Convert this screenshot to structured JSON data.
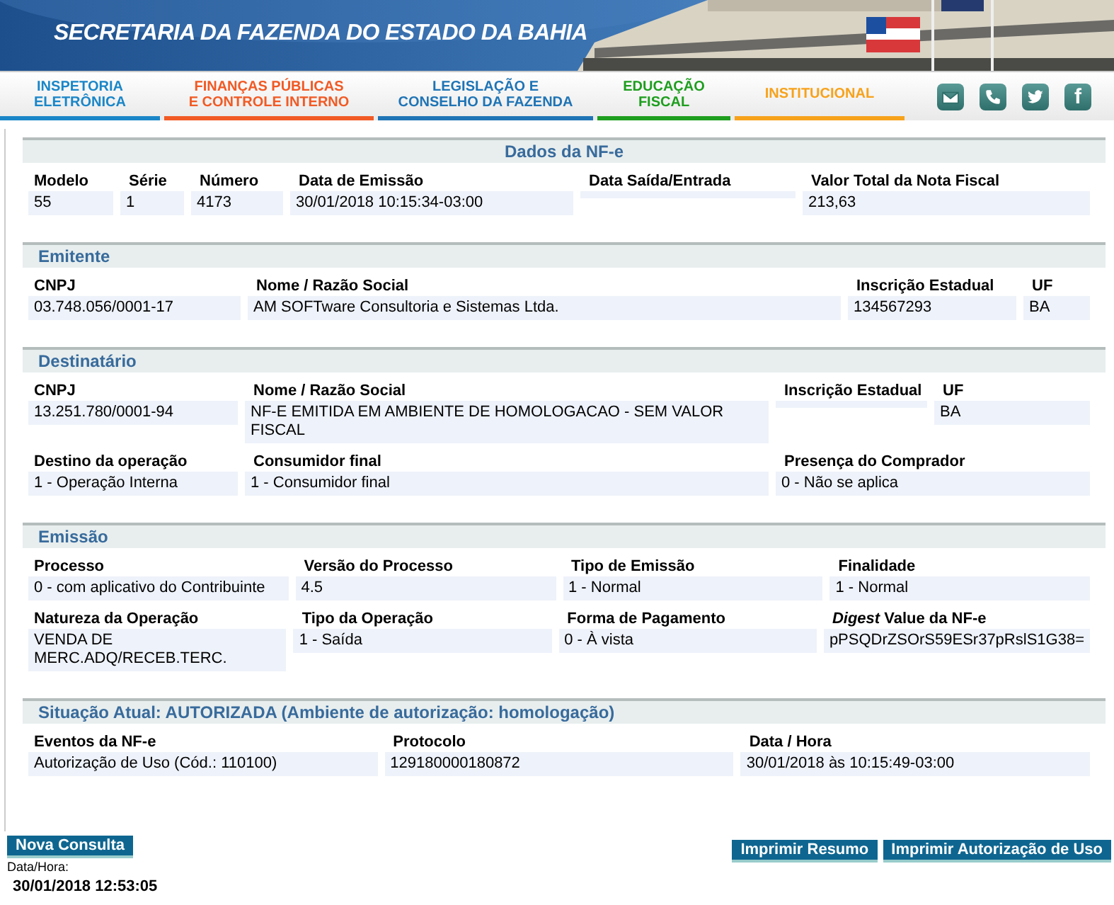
{
  "header": {
    "title": "SECRETARIA DA FAZENDA DO ESTADO DA BAHIA"
  },
  "nav": [
    {
      "lines": [
        "INSPETORIA",
        "ELETRÔNICA"
      ],
      "color": "#1a86c8"
    },
    {
      "lines": [
        "FINANÇAS PÚBLICAS",
        "E CONTROLE INTERNO"
      ],
      "color": "#f15a24"
    },
    {
      "lines": [
        "LEGISLAÇÃO E",
        "CONSELHO DA FAZENDA"
      ],
      "color": "#1f74b5"
    },
    {
      "lines": [
        "EDUCAÇÃO",
        "FISCAL"
      ],
      "color": "#1e9e1e"
    },
    {
      "lines": [
        "INSTITUCIONAL"
      ],
      "color": "#f7a21b"
    }
  ],
  "social": [
    {
      "kind": "mail"
    },
    {
      "kind": "phone"
    },
    {
      "kind": "twitter"
    },
    {
      "kind": "facebook",
      "glyph": "f"
    }
  ],
  "sections": [
    {
      "title": "Dados da NF-e",
      "centered": true,
      "rows": [
        [
          {
            "label": "Modelo",
            "value": "55"
          },
          {
            "label": "Série",
            "value": "1"
          },
          {
            "label": "Número",
            "value": "4173"
          },
          {
            "label": "Data de Emissão",
            "value": "30/01/2018 10:15:34-03:00"
          },
          {
            "label": "Data Saída/Entrada"
          },
          {
            "label": "Valor Total da Nota Fiscal",
            "value": "213,63"
          }
        ]
      ]
    },
    {
      "title": "Emitente",
      "centered": false,
      "rows": [
        [
          {
            "label": "CNPJ",
            "value": "03.748.056/0001-17"
          },
          {
            "label": "Nome / Razão Social",
            "value": "AM SOFTware Consultoria e Sistemas Ltda."
          },
          {
            "label": "Inscrição Estadual",
            "value": "134567293"
          },
          {
            "label": "UF",
            "value": "BA"
          }
        ]
      ]
    },
    {
      "title": "Destinatário",
      "centered": false,
      "rows": [
        [
          {
            "label": "CNPJ",
            "value": "13.251.780/0001-94"
          },
          {
            "label": "Nome / Razão Social",
            "value": "NF-E EMITIDA EM AMBIENTE DE HOMOLOGACAO - SEM VALOR FISCAL"
          },
          {
            "label": "Inscrição Estadual"
          },
          {
            "label": "UF",
            "value": "BA"
          }
        ],
        [
          {
            "label": "Destino da operação",
            "value": "1 - Operação Interna"
          },
          {
            "label": "Consumidor final",
            "value": "1 - Consumidor final"
          },
          {
            "label": "Presença do Comprador",
            "value": "0 - Não se aplica"
          }
        ]
      ]
    },
    {
      "title": "Emissão",
      "centered": false,
      "rows": [
        [
          {
            "label": "Processo",
            "value": "0 - com aplicativo do Contribuinte"
          },
          {
            "label": "Versão do Processo",
            "value": "4.5"
          },
          {
            "label": "Tipo de Emissão",
            "value": "1 - Normal"
          },
          {
            "label": "Finalidade",
            "value": "1 - Normal"
          }
        ],
        [
          {
            "label": "Natureza da Operação",
            "value": "VENDA DE MERC.ADQ/RECEB.TERC."
          },
          {
            "label": "Tipo da Operação",
            "value": "1 - Saída"
          },
          {
            "label": "Forma de Pagamento",
            "value": "0 - À vista"
          },
          {
            "label": "*Digest* Value da NF-e",
            "value": "pPSQDrZSOrS59ESr37pRslS1G38="
          }
        ]
      ]
    },
    {
      "title": "Situação Atual:  AUTORIZADA (Ambiente de autorização: homologação)",
      "centered": false,
      "rows": [
        [
          {
            "label": "Eventos da NF-e",
            "value": "Autorização de Uso (Cód.: 110100)"
          },
          {
            "label": "Protocolo",
            "value": "129180000180872"
          },
          {
            "label": "Data / Hora",
            "value": "30/01/2018 às 10:15:49-03:00"
          }
        ]
      ]
    }
  ],
  "footer": {
    "new_query": "Nova Consulta",
    "timestamp_label": "Data/Hora:",
    "timestamp": "30/01/2018 12:53:05",
    "buttons": [
      "Imprimir Resumo",
      "Imprimir Autorização de Uso"
    ]
  }
}
